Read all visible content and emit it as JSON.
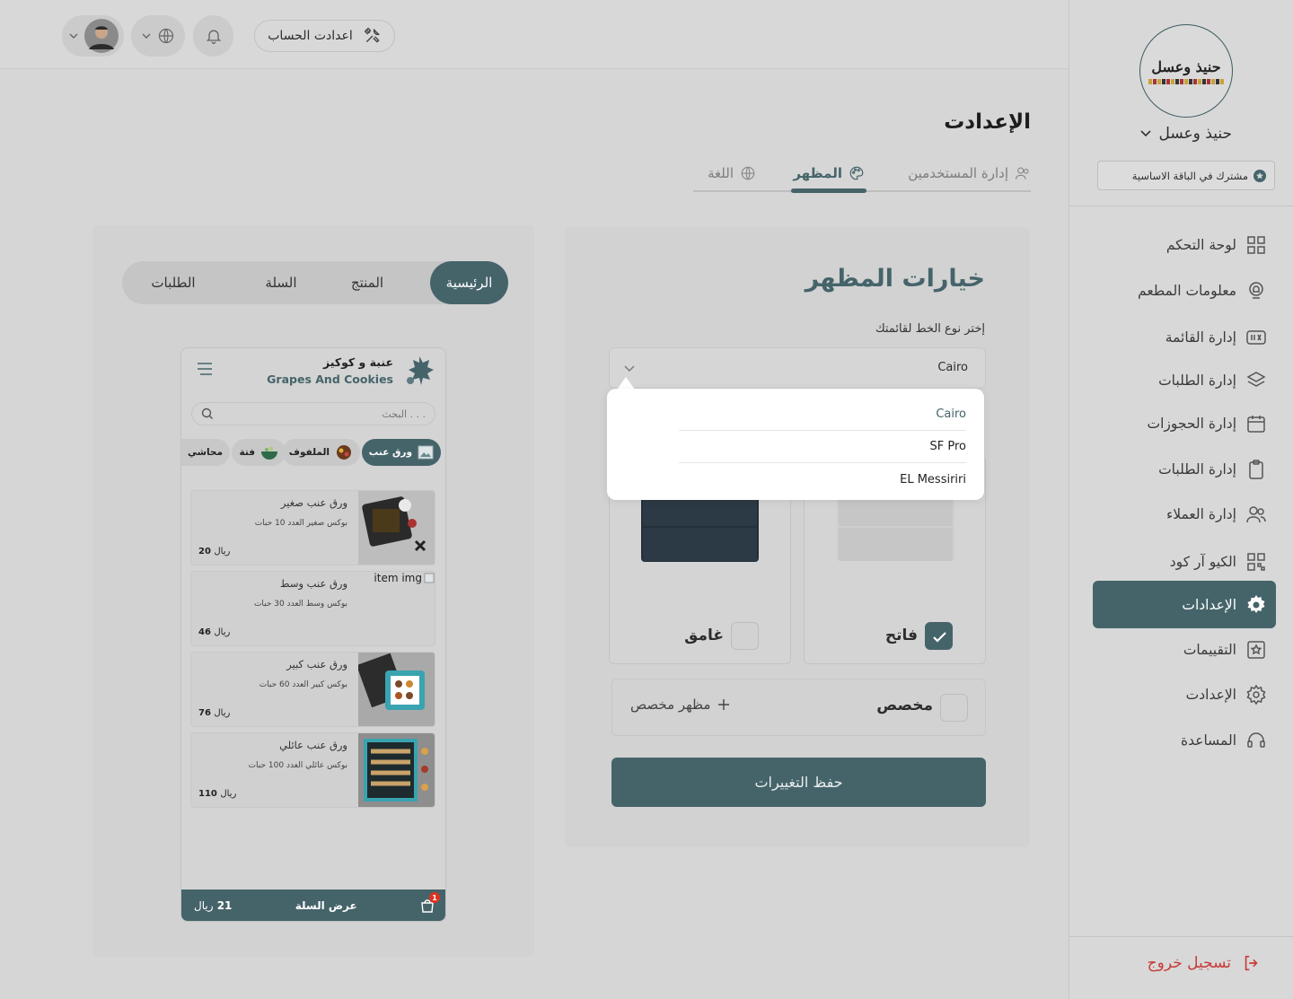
{
  "colors": {
    "accent": "#45646a",
    "logout": "#c73c38",
    "background": "#d6d6d6"
  },
  "sidebar": {
    "logo_text": "حنيذ وعسل",
    "restaurant_name": "حنيذ وعسل",
    "plan": "مشترك في الباقة الاساسية",
    "items": [
      {
        "label": "لوحة التحكم",
        "icon": "grid-icon"
      },
      {
        "label": "معلومات المطعم",
        "icon": "chef-icon"
      },
      {
        "label": "إدارة القائمة",
        "icon": "menu-icon"
      },
      {
        "label": "إدارة الطلبات",
        "icon": "layers-icon"
      },
      {
        "label": "إدارة الحجوزات",
        "icon": "calendar-icon"
      },
      {
        "label": "إدارة الطلبات",
        "icon": "clipboard-icon"
      },
      {
        "label": "إدارة العملاء",
        "icon": "users-icon"
      },
      {
        "label": "الكيو آر كود",
        "icon": "qr-icon"
      },
      {
        "label": "الإعدادات",
        "icon": "gear-icon"
      },
      {
        "label": "التقييمات",
        "icon": "star-icon"
      },
      {
        "label": "الإعدادت",
        "icon": "settings-icon"
      },
      {
        "label": "المساعدة",
        "icon": "headset-icon"
      }
    ],
    "active_index": 8,
    "logout": "تسجيل خروج"
  },
  "header": {
    "account_settings": "اعدادت الحساب"
  },
  "page": {
    "title": "الإعدادت",
    "tabs": [
      {
        "label": "إدارة المستخدمين",
        "icon": "users-icon"
      },
      {
        "label": "المظهر",
        "icon": "palette-icon"
      },
      {
        "label": "اللغة",
        "icon": "globe-icon"
      }
    ],
    "active_tab": 1
  },
  "appearance": {
    "title": "خيارات المظهر",
    "font_label": "إختر نوع الخط لقائمتك",
    "font_selected": "Cairo",
    "font_options": [
      "Cairo",
      "SF Pro",
      "EL Messiriri"
    ],
    "themes": [
      {
        "label": "فاتح",
        "checked": true
      },
      {
        "label": "غامق",
        "checked": false
      }
    ],
    "custom_label": "مخصص",
    "custom_button": "مظهر مخصص",
    "save": "حفظ التغييرات"
  },
  "preview": {
    "tabs": [
      "الرئيسية",
      "المنتج",
      "السلة",
      "الطلبات"
    ],
    "active_tab": 0,
    "brand_ar": "عنبة و كوكيز",
    "brand_en": "Grapes And Cookies",
    "search_placeholder": "البحث . . .",
    "categories": [
      "ورق عنب",
      "الملفوف",
      "فتة",
      "محاشي"
    ],
    "items": [
      {
        "name": "ورق عنب صغير",
        "desc": "بوكس صغير العدد 10 حبات",
        "price": "20",
        "has_image": true
      },
      {
        "name": "ورق عنب وسط",
        "desc": "بوكس وسط العدد 30 حبات",
        "price": "46",
        "has_image": false
      },
      {
        "name": "ورق عنب كبير",
        "desc": "بوكس كبير العدد 60 حبات",
        "price": "76",
        "has_image": true
      },
      {
        "name": "ورق عنب عائلي",
        "desc": "بوكس عائلي العدد 100 حبات",
        "price": "110",
        "has_image": true
      }
    ],
    "currency": "ريال",
    "broken_image_alt": "item img",
    "cart": {
      "label": "عرض السلة",
      "total": "21",
      "count": "1"
    }
  }
}
